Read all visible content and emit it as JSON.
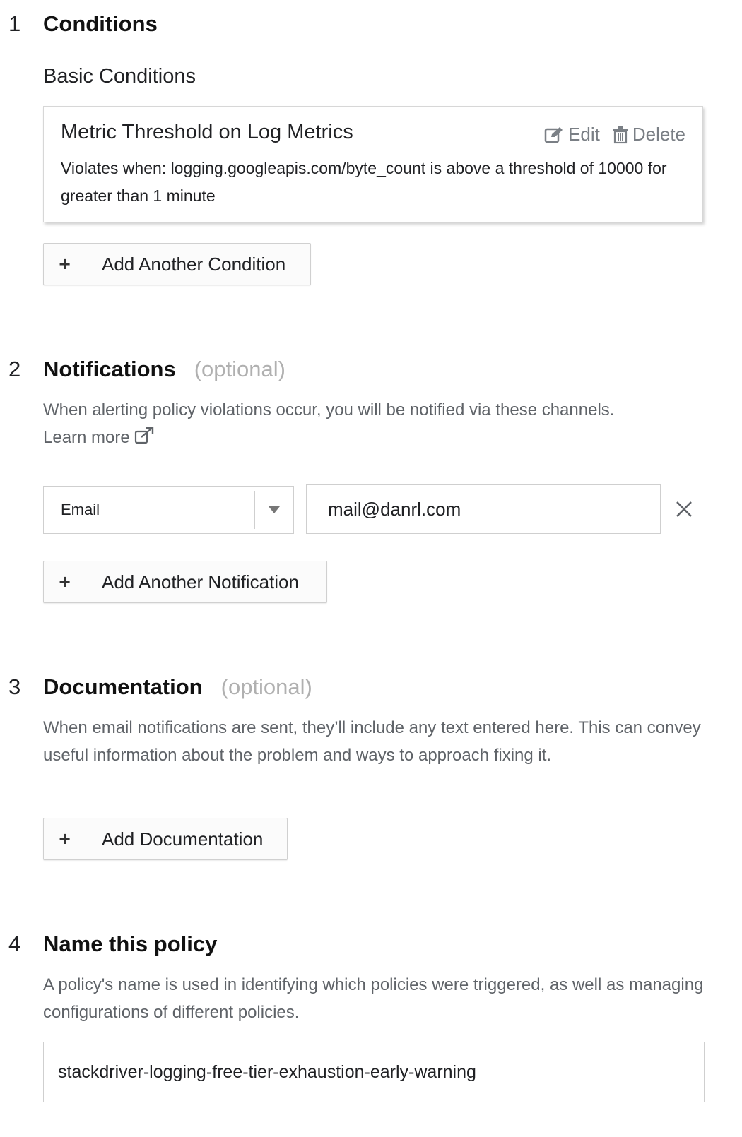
{
  "sections": {
    "conditions": {
      "number": "1",
      "title": "Conditions",
      "subheading": "Basic Conditions",
      "card": {
        "title": "Metric Threshold on Log Metrics",
        "edit_label": "Edit",
        "delete_label": "Delete",
        "body": "Violates when: logging.googleapis.com/byte_count is above a threshold of 10000 for greater than 1 minute"
      },
      "add_button_label": "Add Another Condition"
    },
    "notifications": {
      "number": "2",
      "title": "Notifications",
      "optional_label": "(optional)",
      "description": "When alerting policy violations occur, you will be notified via these channels.",
      "learn_more": "Learn more",
      "channel_type": "Email",
      "channel_value": "mail@danrl.com",
      "add_button_label": "Add Another Notification"
    },
    "documentation": {
      "number": "3",
      "title": "Documentation",
      "optional_label": "(optional)",
      "description": "When email notifications are sent, they’ll include any text entered here. This can convey useful information about the problem and ways to approach fixing it.",
      "add_button_label": "Add Documentation"
    },
    "name_policy": {
      "number": "4",
      "title": "Name this policy",
      "description": "A policy's name is used in identifying which policies were triggered, as well as managing configurations of different policies.",
      "policy_name": "stackdriver-logging-free-tier-exhaustion-early-warning"
    }
  },
  "icons": {
    "edit": "edit-icon",
    "delete": "trash-icon",
    "external_link": "external-link-icon",
    "dropdown": "chevron-down-icon",
    "remove": "close-icon",
    "add": "plus-icon"
  },
  "colors": {
    "text": "#202124",
    "muted": "#5f6368",
    "optional": "#b0b0b0",
    "border": "#cfcfcf"
  }
}
